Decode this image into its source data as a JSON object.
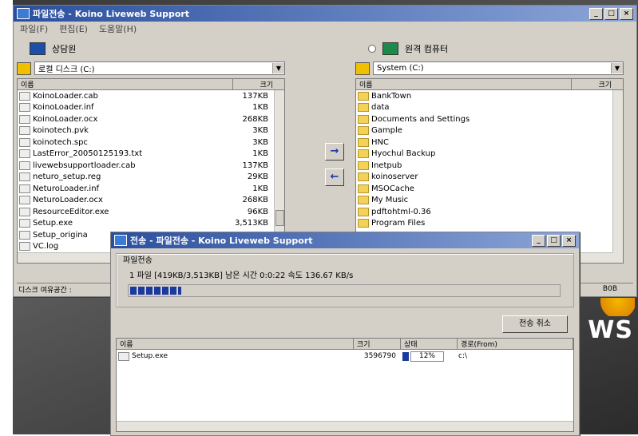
{
  "main_window": {
    "title": "파일전송 - Koino Liveweb Support",
    "menu": [
      "파일(F)",
      "편집(E)",
      "도움말(H)"
    ],
    "controls": {
      "minimize": "_",
      "maximize": "□",
      "close": "×"
    }
  },
  "local": {
    "label": "상담원",
    "drive": "로컬 디스크 (C:)",
    "col_name": "이름",
    "col_size": "크기",
    "files": [
      {
        "name": "KoinoLoader.cab",
        "size": "137KB"
      },
      {
        "name": "KoinoLoader.inf",
        "size": "1KB"
      },
      {
        "name": "KoinoLoader.ocx",
        "size": "268KB"
      },
      {
        "name": "koinotech.pvk",
        "size": "3KB"
      },
      {
        "name": "koinotech.spc",
        "size": "3KB"
      },
      {
        "name": "LastError_20050125193.txt",
        "size": "1KB"
      },
      {
        "name": "livewebsupportloader.cab",
        "size": "137KB"
      },
      {
        "name": "neturo_setup.reg",
        "size": "29KB"
      },
      {
        "name": "NeturoLoader.inf",
        "size": "1KB"
      },
      {
        "name": "NeturoLoader.ocx",
        "size": "268KB"
      },
      {
        "name": "ResourceEditor.exe",
        "size": "96KB"
      },
      {
        "name": "Setup.exe",
        "size": "3,513KB"
      },
      {
        "name": "Setup_origina",
        "size": ""
      },
      {
        "name": "VC.log",
        "size": ""
      }
    ],
    "status": "디스크 여유공간 :"
  },
  "remote": {
    "label": "원격 컴퓨터",
    "drive": "System (C:)",
    "col_name": "이름",
    "col_size": "크기",
    "folders": [
      "BankTown",
      "data",
      "Documents and Settings",
      "Gample",
      "HNC",
      "Hyochul Backup",
      "Inetpub",
      "koinoserver",
      "MSOCache",
      "My Music",
      "pdftohtml-0.36",
      "Program Files"
    ],
    "status_right": "B0B"
  },
  "transfer_buttons": {
    "to_remote": "→",
    "to_local": "←"
  },
  "dialog": {
    "title": "전송 - 파일전송 - Koino Liveweb Support",
    "group_label": "파일전송",
    "progress_text": "1 파일 [419KB/3,513KB] 남은 시간 0:0:22 속도 136.67 KB/s",
    "progress_percent": 12,
    "cancel_label": "전송 취소",
    "columns": {
      "name": "이름",
      "size": "크기",
      "status": "상태",
      "source": "경로(From)"
    },
    "rows": [
      {
        "name": "Setup.exe",
        "size": "3596790",
        "status": "12%",
        "source": "c:\\"
      }
    ]
  },
  "desktop": {
    "logo_text": "WS"
  }
}
